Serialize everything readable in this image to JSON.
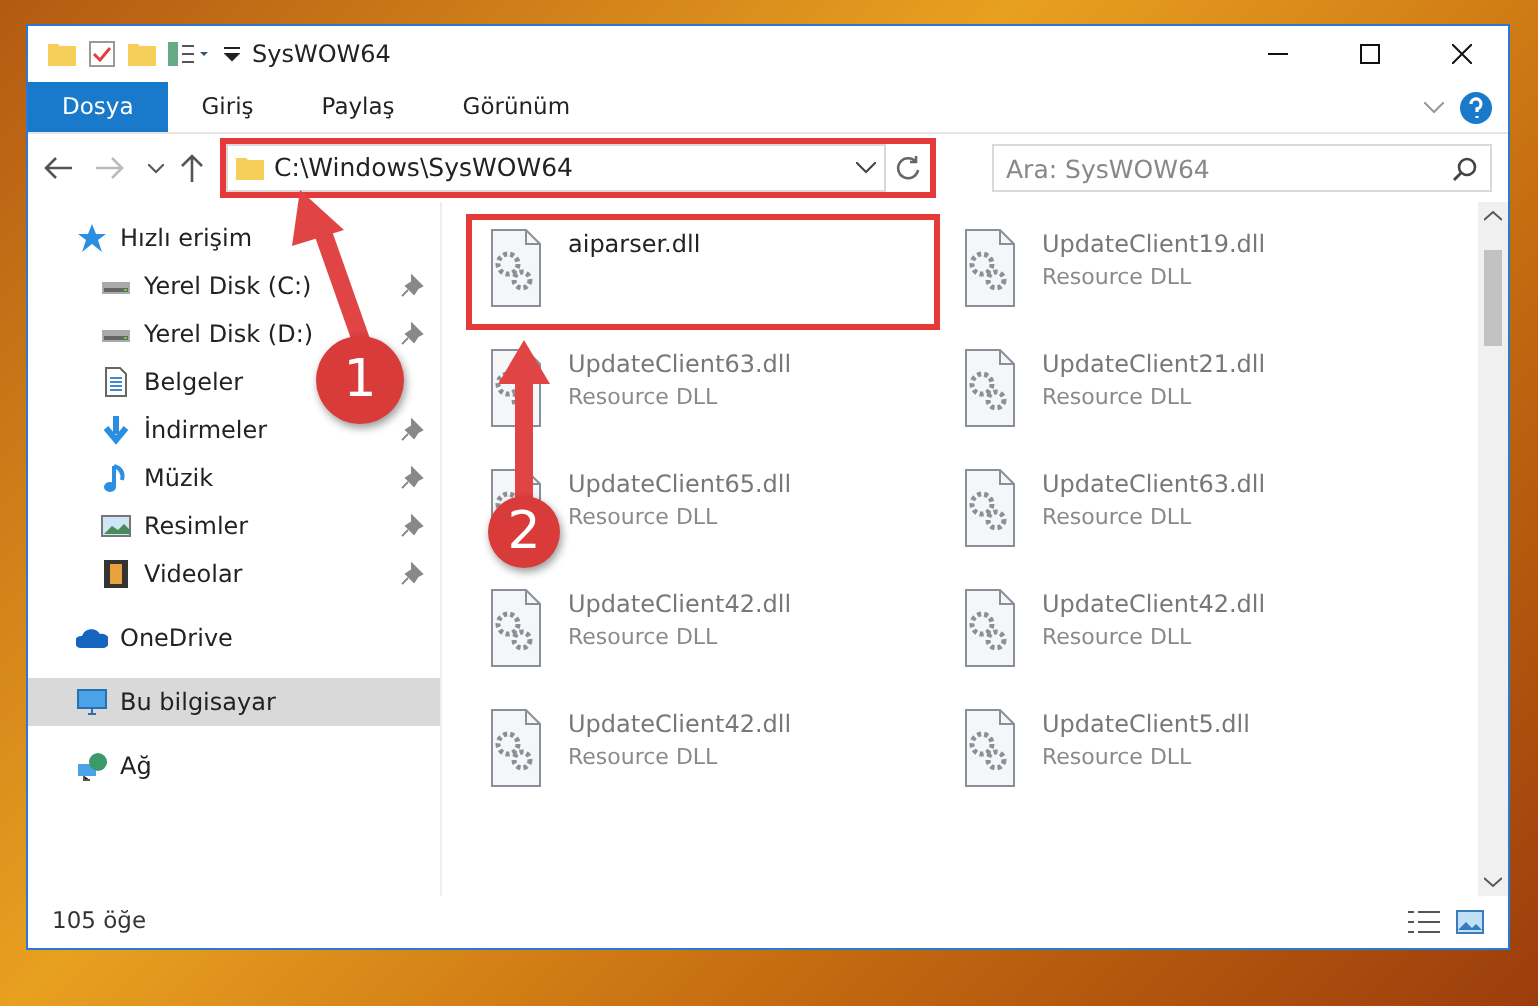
{
  "window": {
    "title": "SysWOW64"
  },
  "ribbon_tabs": [
    {
      "label": "Dosya",
      "selected": true
    },
    {
      "label": "Giriş",
      "selected": false
    },
    {
      "label": "Paylaş",
      "selected": false
    },
    {
      "label": "Görünüm",
      "selected": false
    }
  ],
  "address": {
    "value": "C:\\Windows\\SysWOW64"
  },
  "search": {
    "placeholder": "Ara: SysWOW64"
  },
  "sidebar": {
    "items": [
      {
        "label": "Hızlı erişim",
        "kind": "star",
        "pinned": false,
        "selected": false,
        "children": [
          {
            "label": "Yerel Disk (C:)",
            "kind": "drive",
            "pinned": true,
            "selected": false
          },
          {
            "label": "Yerel Disk (D:)",
            "kind": "drive",
            "pinned": true,
            "selected": false
          },
          {
            "label": "Belgeler",
            "kind": "document",
            "pinned": false,
            "selected": false
          },
          {
            "label": "İndirmeler",
            "kind": "download",
            "pinned": true,
            "selected": false
          },
          {
            "label": "Müzik",
            "kind": "music",
            "pinned": true,
            "selected": false
          },
          {
            "label": "Resimler",
            "kind": "picture",
            "pinned": true,
            "selected": false
          },
          {
            "label": "Videolar",
            "kind": "video",
            "pinned": true,
            "selected": false
          }
        ]
      },
      {
        "label": "OneDrive",
        "kind": "cloud",
        "pinned": false,
        "selected": false
      },
      {
        "label": "Bu bilgisayar",
        "kind": "computer",
        "pinned": false,
        "selected": true
      },
      {
        "label": "Ağ",
        "kind": "network",
        "pinned": false,
        "selected": false
      }
    ]
  },
  "files": [
    {
      "name": "aiparser.dll",
      "dimmed": false,
      "highlighted": true
    },
    {
      "name": "UpdateClient19.dll",
      "type": "Resource DLL",
      "dimmed": true,
      "highlighted": false
    },
    {
      "name": "UpdateClient63.dll",
      "type": "Resource DLL",
      "dimmed": true,
      "highlighted": false
    },
    {
      "name": "UpdateClient21.dll",
      "type": "Resource DLL",
      "dimmed": true,
      "highlighted": false
    },
    {
      "name": "UpdateClient65.dll",
      "type": "Resource DLL",
      "dimmed": true,
      "highlighted": false
    },
    {
      "name": "UpdateClient63.dll",
      "type": "Resource DLL",
      "dimmed": true,
      "highlighted": false
    },
    {
      "name": "UpdateClient42.dll",
      "type": "Resource DLL",
      "dimmed": true,
      "highlighted": false
    },
    {
      "name": "UpdateClient42.dll",
      "type": "Resource DLL",
      "dimmed": true,
      "highlighted": false
    },
    {
      "name": "UpdateClient42.dll",
      "type": "Resource DLL",
      "dimmed": true,
      "highlighted": false
    },
    {
      "name": "UpdateClient5.dll",
      "type": "Resource DLL",
      "dimmed": true,
      "highlighted": false
    }
  ],
  "status_bar": {
    "count": "105 öğe"
  },
  "annotations": [
    {
      "label": "1"
    },
    {
      "label": "2"
    }
  ]
}
